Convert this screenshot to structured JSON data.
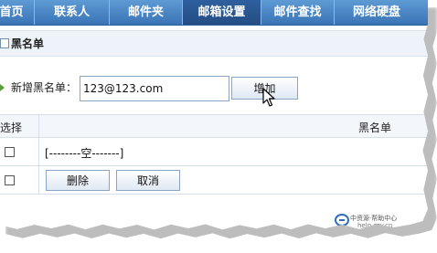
{
  "nav": {
    "tabs": [
      {
        "label": "首页",
        "active": false
      },
      {
        "label": "联系人",
        "active": false
      },
      {
        "label": "邮件夹",
        "active": false
      },
      {
        "label": "邮箱设置",
        "active": true
      },
      {
        "label": "邮件查找",
        "active": false
      },
      {
        "label": "网络硬盘",
        "active": false
      }
    ]
  },
  "section": {
    "title": "黑名单"
  },
  "add": {
    "label": "新增黑名单：",
    "input_value": "123@123.com",
    "button_label": "增加"
  },
  "table": {
    "headers": {
      "select": "选择",
      "blacklist": "黑名单"
    },
    "empty_text": "[--------空-------]",
    "delete_label": "删除",
    "cancel_label": "取消"
  },
  "watermark": {
    "line1": "中资源·帮助中心",
    "line2": "help.zzy.cn"
  },
  "colors": {
    "nav_bg": "#4a86c5",
    "nav_active": "#2a5690",
    "accent_green": "#5a9e3e"
  }
}
